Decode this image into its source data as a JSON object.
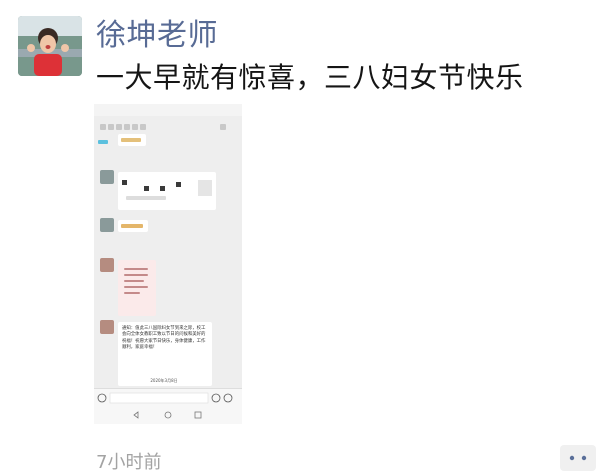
{
  "post": {
    "author": "徐坤老师",
    "text": "一大早就有惊喜，三八妇女节快乐",
    "time": "7小时前"
  },
  "screenshot": {
    "message_text": "通知：值此三八国际妇女节到来之际，校工会向全体女教职工致以节日的问候和美好的祝福！祝愿大家节日快乐，身体健康，工作顺利，家庭幸福！",
    "message_date": "2020年3月8日"
  }
}
